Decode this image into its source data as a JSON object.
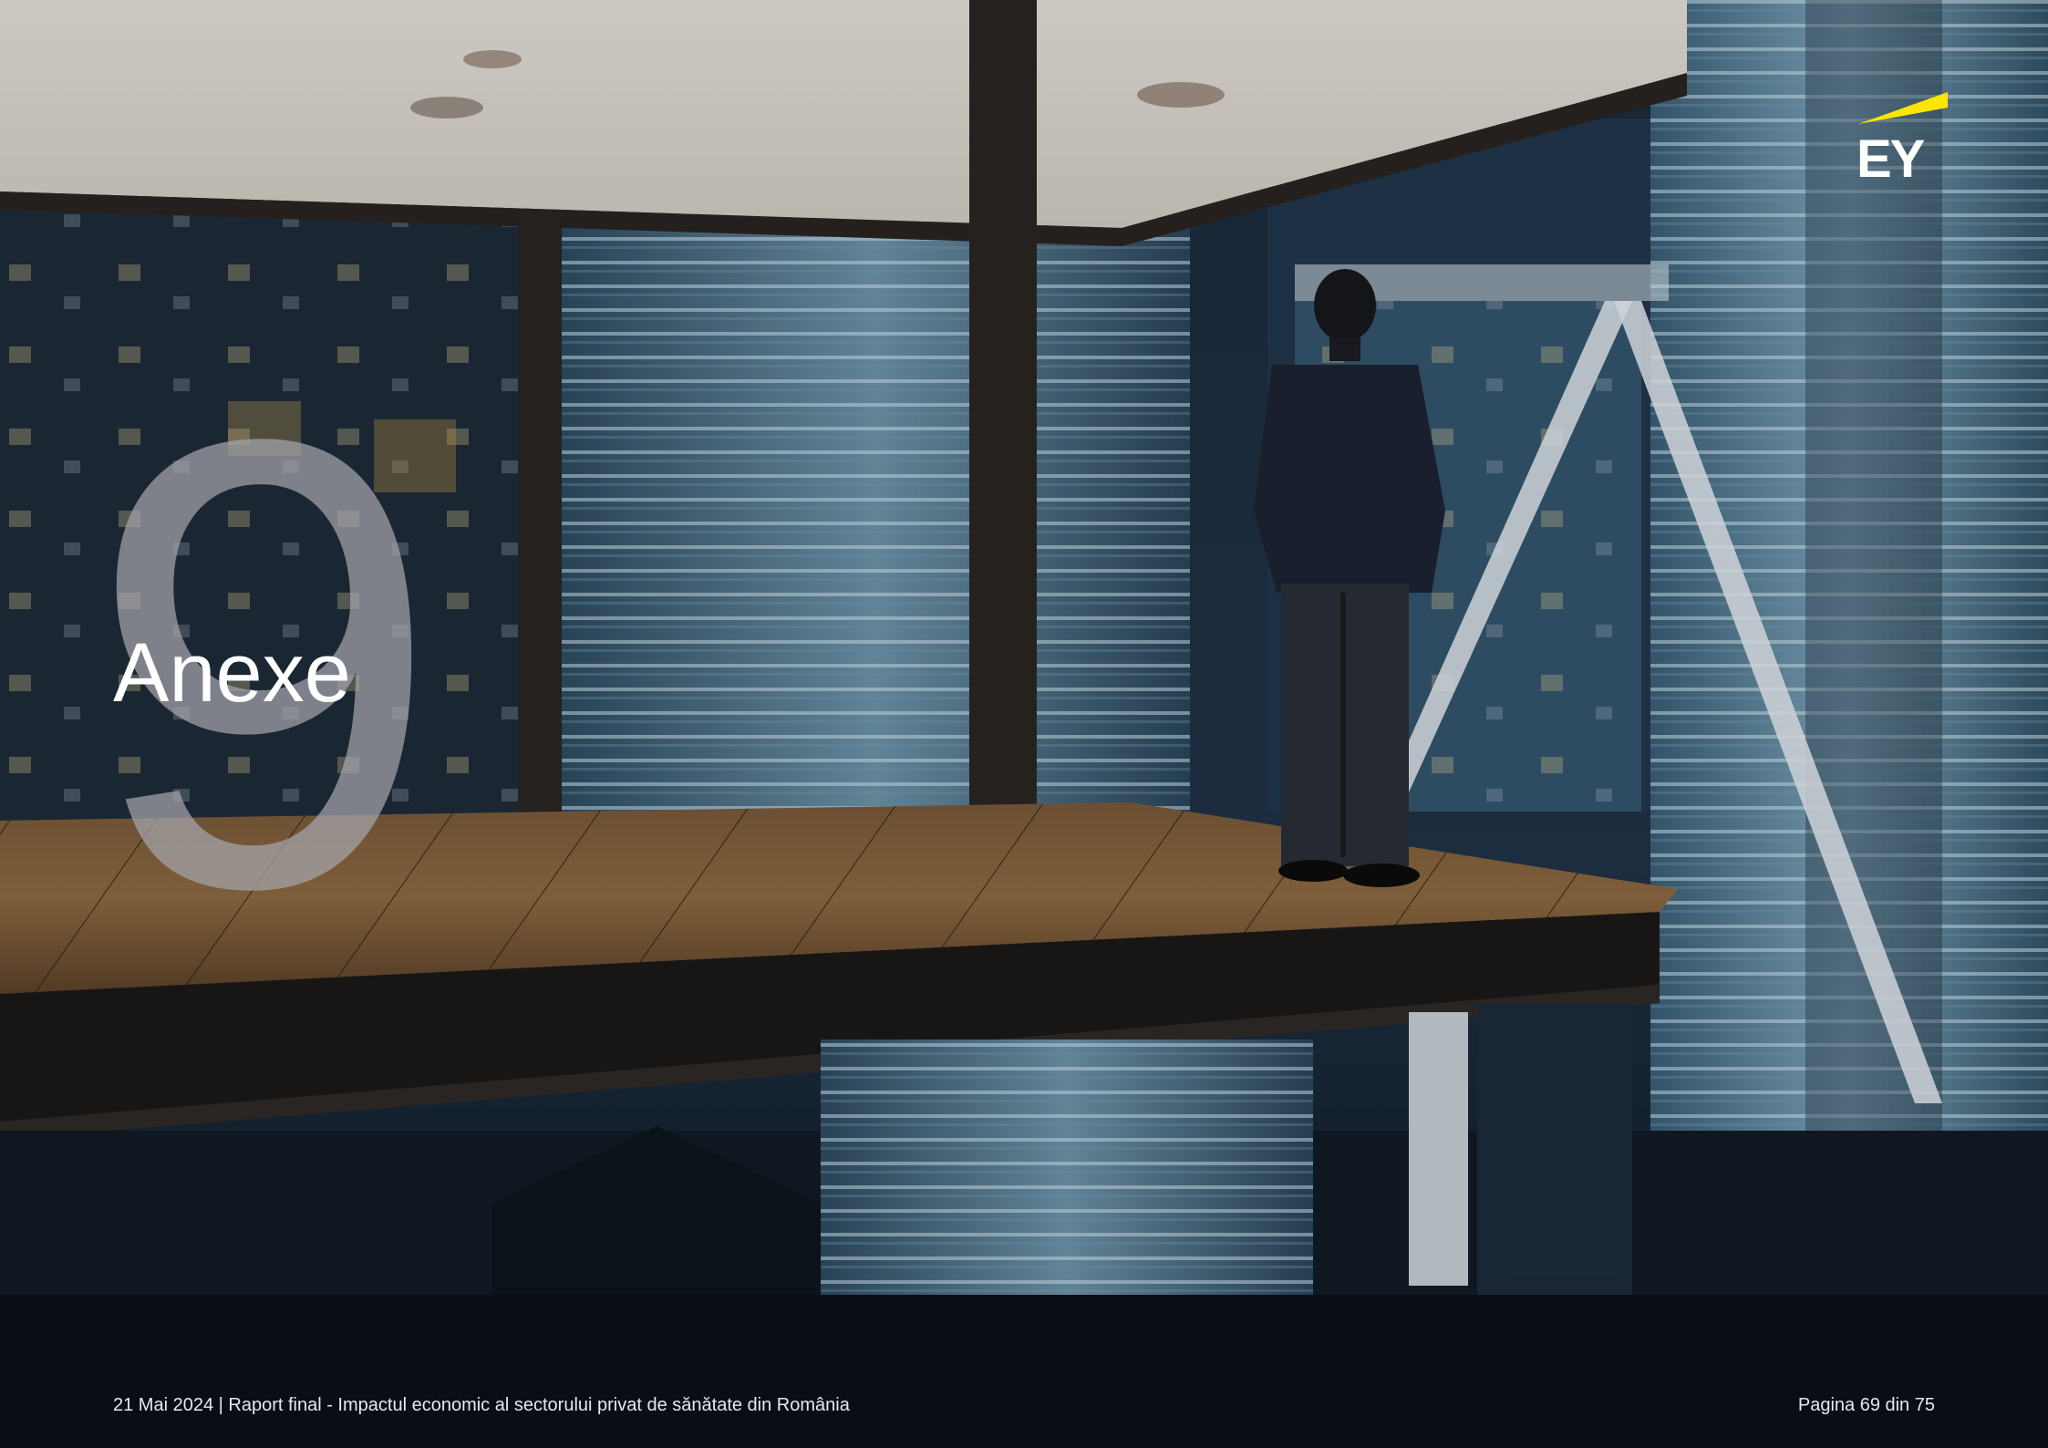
{
  "chapter": {
    "number": "9",
    "title": "Anexe"
  },
  "brand": {
    "logo_text": "EY",
    "accent_color": "#ffe600"
  },
  "footer": {
    "document_info": "21 Mai 2024 | Raport final - Impactul economic al sectorului privat de sănătate din România",
    "page_label": "Pagina 69 din 75"
  },
  "background": {
    "description_icon": "city-night-office-photo"
  }
}
